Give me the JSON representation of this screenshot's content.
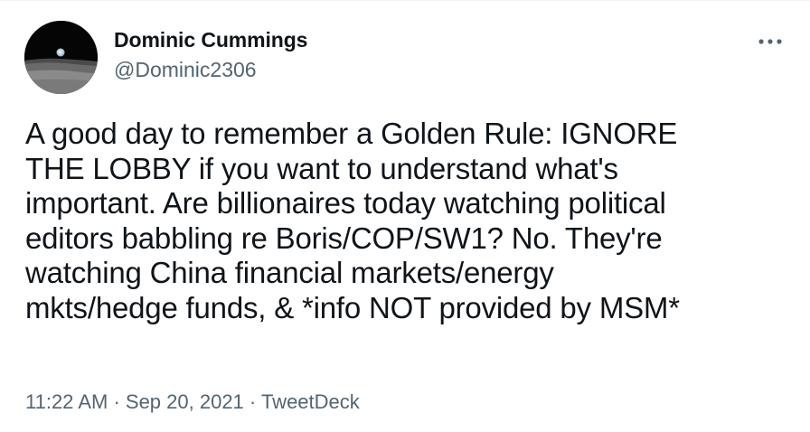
{
  "tweet": {
    "display_name": "Dominic Cummings",
    "handle": "@Dominic2306",
    "text": "A good day to remember a Golden Rule: IGNORE\nTHE LOBBY if you want to understand what's\nimportant. Are billionaires today watching political\neditors babbling re Boris/COP/SW1? No. They're\nwatching China financial markets/energy\nmkts/hedge funds, & *info NOT provided by MSM*",
    "time": "11:22 AM",
    "separator": " · ",
    "date": "Sep 20, 2021",
    "source": "TweetDeck"
  },
  "icons": {
    "more": "more-horizontal-icon",
    "avatar": "earthrise-avatar"
  },
  "colors": {
    "text_primary": "#0f1419",
    "text_secondary": "#536471",
    "background": "#ffffff"
  }
}
